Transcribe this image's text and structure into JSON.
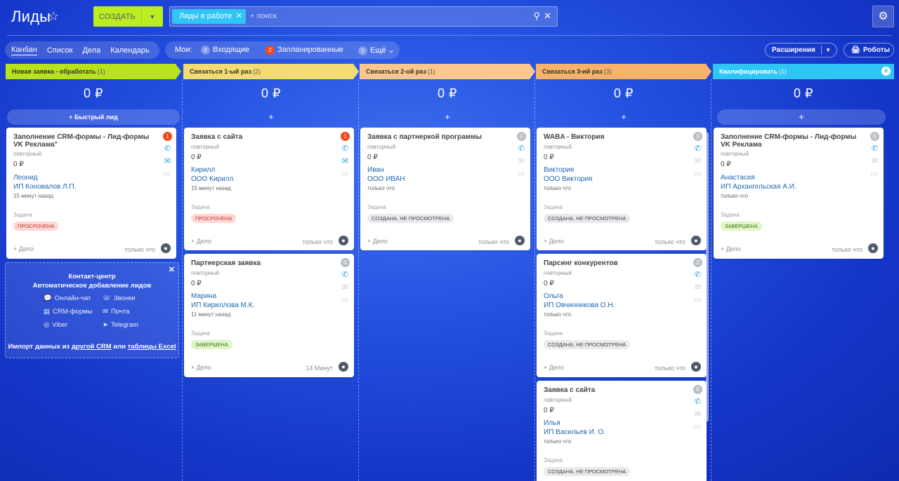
{
  "header": {
    "title": "Лиды",
    "create_label": "СОЗДАТЬ",
    "filter_chip": "Лиды в работе",
    "search_placeholder": "+ поиск"
  },
  "views": {
    "kanban": "Канбан",
    "list": "Список",
    "deals": "Дела",
    "calendar": "Календарь"
  },
  "counters": {
    "label": "Мои:",
    "incoming_count": "0",
    "incoming": "Входящие",
    "planned_count": "2",
    "planned": "Запланированные",
    "more_count": "0",
    "more": "Ещё"
  },
  "buttons": {
    "extensions": "Расширения",
    "robots": "Роботы"
  },
  "columns": [
    {
      "title": "Новая заявка - обработать",
      "count": "(1)",
      "color": "#b8e21c",
      "sum": "0 ₽",
      "add": "+ Быстрый лид"
    },
    {
      "title": "Связаться 1-ый раз",
      "count": "(2)",
      "color": "#f4dc73",
      "sum": "0 ₽",
      "add": "+"
    },
    {
      "title": "Связаться 2-ой раз",
      "count": "(1)",
      "color": "#fbc78e",
      "sum": "0 ₽",
      "add": "+"
    },
    {
      "title": "Связаться 3-ий раз",
      "count": "(3)",
      "color": "#f9b26a",
      "sum": "0 ₽",
      "add": "+"
    },
    {
      "title": "Квалифицировать",
      "count": "(1)",
      "color": "#2fc6f6",
      "sum": "0 ₽",
      "add": "+"
    }
  ],
  "cards": [
    {
      "title": "Заполнение CRM-формы - Лид-формы VK Реклама\"",
      "sub": "повторный",
      "price": "0 ₽",
      "name": "Леонид",
      "company": "ИП Коновалов Л.П.",
      "time": "15 минут назад",
      "task": "Задача",
      "tag": "ПРОСРОЧЕНА",
      "deal": "+ Дело",
      "stamp": "только что",
      "badge": "1"
    },
    {
      "title": "Заявка с сайта",
      "sub": "повторный",
      "price": "0 ₽",
      "name": "Кирилл",
      "company": "ООО Кирилл",
      "time": "15 минут назад",
      "task": "Задача",
      "tag": "ПРОСРОЧЕНА",
      "deal": "+ Дело",
      "stamp": "только что",
      "badge": "1"
    },
    {
      "title": "Партнерская заявка",
      "sub": "повторный",
      "price": "0 ₽",
      "name": "Марина",
      "company": "ИП Кириллова М.К.",
      "time": "11 минут назад",
      "task": "Задача",
      "tag": "ЗАВЕРШЕНА",
      "deal": "+ Дело",
      "stamp": "14 Минут",
      "badge": "0"
    },
    {
      "title": "Заявка с партнеркой программы",
      "sub": "повторный",
      "price": "0 ₽",
      "name": "Иван",
      "company": "ООО ИВАН",
      "time": "только что",
      "task": "Задача",
      "tag": "СОЗДАНА, НЕ ПРОСМОТРЕНА",
      "deal": "+ Дело",
      "stamp": "только что",
      "badge": "0"
    },
    {
      "title": "WABA - Виктория",
      "sub": "повторный",
      "price": "0 ₽",
      "name": "Виктория",
      "company": "ООО Виктория",
      "time": "только что",
      "task": "Задача",
      "tag": "СОЗДАНА, НЕ ПРОСМОТРЕНА",
      "deal": "+ Дело",
      "stamp": "только что",
      "badge": "0"
    },
    {
      "title": "Парсинг конкурентов",
      "sub": "повторный",
      "price": "0 ₽",
      "name": "Ольга",
      "company": "ИП Овчинникова О.Н.",
      "time": "только что",
      "task": "Задача",
      "tag": "СОЗДАНА, НЕ ПРОСМОТРЕНА",
      "deal": "+ Дело",
      "stamp": "только что",
      "badge": "0"
    },
    {
      "title": "Заявка с сайта",
      "sub": "повторный",
      "price": "0 ₽",
      "name": "Илья",
      "company": "ИП Васильев И. О.",
      "time": "только что",
      "task": "Задача",
      "tag": "СОЗДАНА, НЕ ПРОСМОТРЕНА",
      "deal": "",
      "stamp": "",
      "badge": "0"
    },
    {
      "title": "Заполнение CRM-формы - Лид-формы VK Реклама",
      "sub": "повторный",
      "price": "0 ₽",
      "name": "Анастасия",
      "company": "ИП Архангельская А.И.",
      "time": "только что",
      "task": "Задача",
      "tag": "ЗАВЕРШЕНА",
      "deal": "+ Дело",
      "stamp": "только что",
      "badge": "0"
    }
  ],
  "contact_center": {
    "title": "Контакт-центр",
    "subtitle": "Автоматическое добавление лидов",
    "items": [
      "Онлайн-чат",
      "Звонки",
      "CRM-формы",
      "Почта",
      "Viber",
      "Telegram"
    ],
    "import_prefix": "Импорт данных из",
    "import_link1": "другой CRM",
    "import_mid": "или",
    "import_link2": "таблицы Excel"
  }
}
